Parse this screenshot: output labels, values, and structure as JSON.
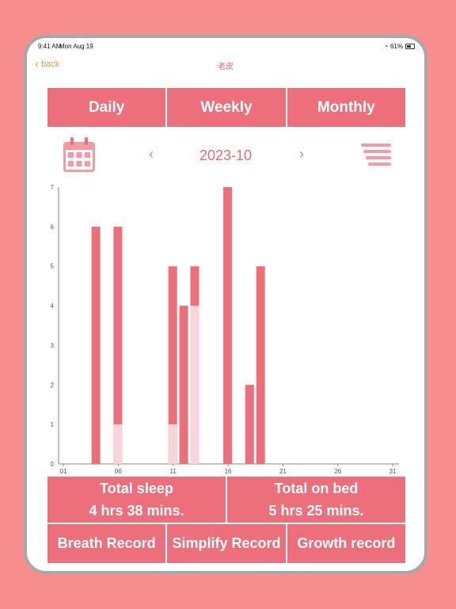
{
  "status": {
    "time": "9:41 AM",
    "date": "Mon Aug 19",
    "battery": "61%"
  },
  "nav": {
    "back": "back",
    "title": "老皮"
  },
  "tabs": [
    {
      "label": "Daily"
    },
    {
      "label": "Weekly"
    },
    {
      "label": "Monthly"
    }
  ],
  "selector": {
    "prev": "‹",
    "month": "2023-10",
    "next": "›"
  },
  "chart_data": {
    "type": "bar",
    "x": [
      "01",
      "06",
      "11",
      "16",
      "21",
      "26",
      "31"
    ],
    "ylim": [
      0,
      7
    ],
    "ytick_labels": [
      "0",
      "1",
      "2",
      "3",
      "4",
      "5",
      "6",
      "7"
    ],
    "bars": [
      {
        "day": 4,
        "total": 6,
        "light": 0
      },
      {
        "day": 6,
        "total": 6,
        "light": 1
      },
      {
        "day": 11,
        "total": 5,
        "light": 1
      },
      {
        "day": 12,
        "total": 4,
        "light": 0
      },
      {
        "day": 13,
        "total": 5,
        "light": 4
      },
      {
        "day": 16,
        "total": 7,
        "light": 0
      },
      {
        "day": 18,
        "total": 2,
        "light": 0
      },
      {
        "day": 19,
        "total": 5,
        "light": 0
      }
    ],
    "colors": {
      "main": "#ec6f7b",
      "light": "#f7d5da"
    }
  },
  "summary": {
    "sleep_label": "Total sleep",
    "sleep_value": "4 hrs 38 mins.",
    "bed_label": "Total on bed",
    "bed_value": "5 hrs 25 mins."
  },
  "actions": [
    {
      "label": "Breath Record"
    },
    {
      "label": "Simplify Record"
    },
    {
      "label": "Growth record"
    }
  ]
}
